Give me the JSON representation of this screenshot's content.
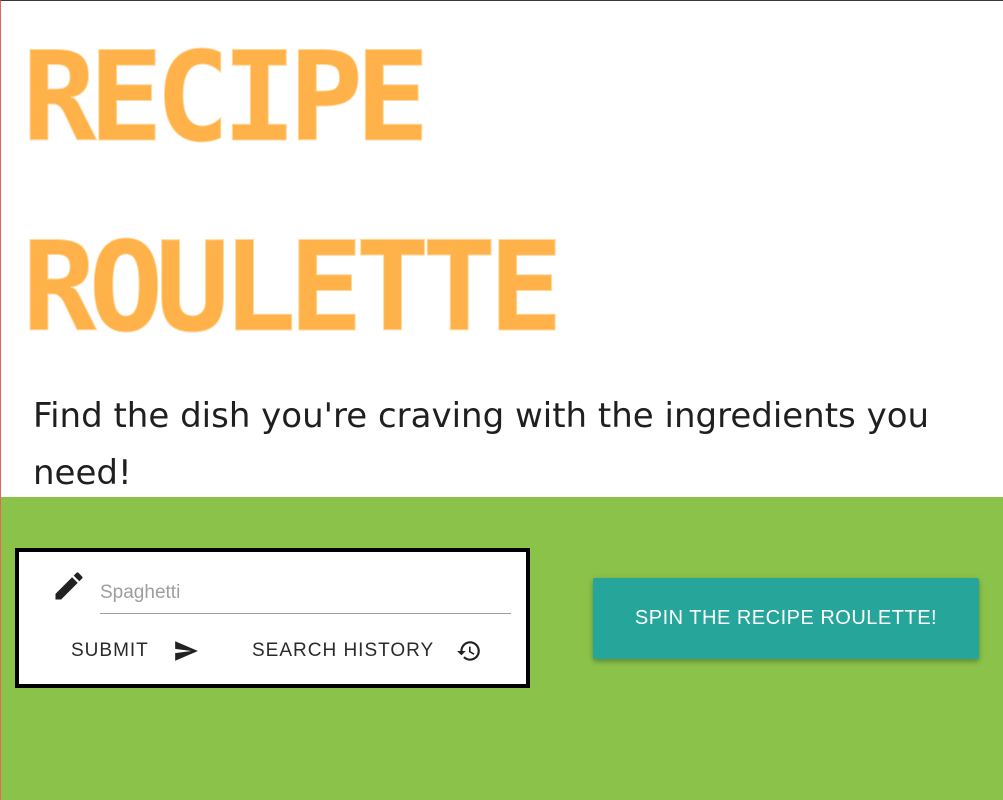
{
  "header": {
    "title_line_1": "RECIPE",
    "title_line_2": "ROULETTE",
    "tagline": "Find the dish you're craving with the ingredients you need!"
  },
  "search": {
    "value": "",
    "placeholder": "Spaghetti",
    "submit_label": "SUBMIT",
    "history_label": "SEARCH HISTORY"
  },
  "spin_button": {
    "label": "SPIN THE RECIPE ROULETTE!"
  },
  "icons": {
    "pencil": "pencil-icon",
    "submit": "send-icon",
    "history": "history-icon"
  },
  "colors": {
    "title": "#ffb24a",
    "main_background": "#8bc34a",
    "spin_button": "#26a69a",
    "card_border": "#000000"
  }
}
